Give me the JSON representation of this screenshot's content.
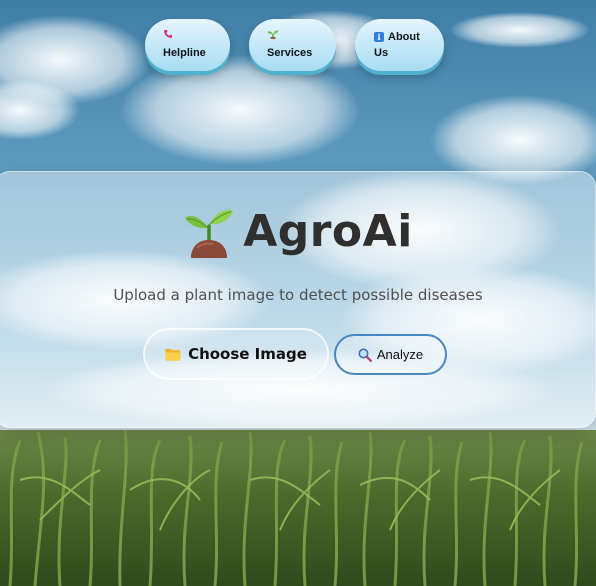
{
  "app": {
    "title": "AgroAi",
    "subtitle": "Upload a plant image to detect possible diseases"
  },
  "nav": {
    "items": [
      {
        "label": "Helpline",
        "icon": "phone-icon"
      },
      {
        "label": "Services",
        "icon": "sprout-icon"
      },
      {
        "label_line1": "About",
        "label_line2": "Us",
        "icon": "info-icon"
      }
    ]
  },
  "actions": {
    "choose_label": "Choose Image",
    "choose_icon": "folder-icon",
    "analyze_label": "Analyze",
    "analyze_icon": "magnifier-icon"
  },
  "colors": {
    "nav_button": "#bfe6f6",
    "analyze_border": "#4a86c0",
    "title_text": "#2f2f2f"
  }
}
